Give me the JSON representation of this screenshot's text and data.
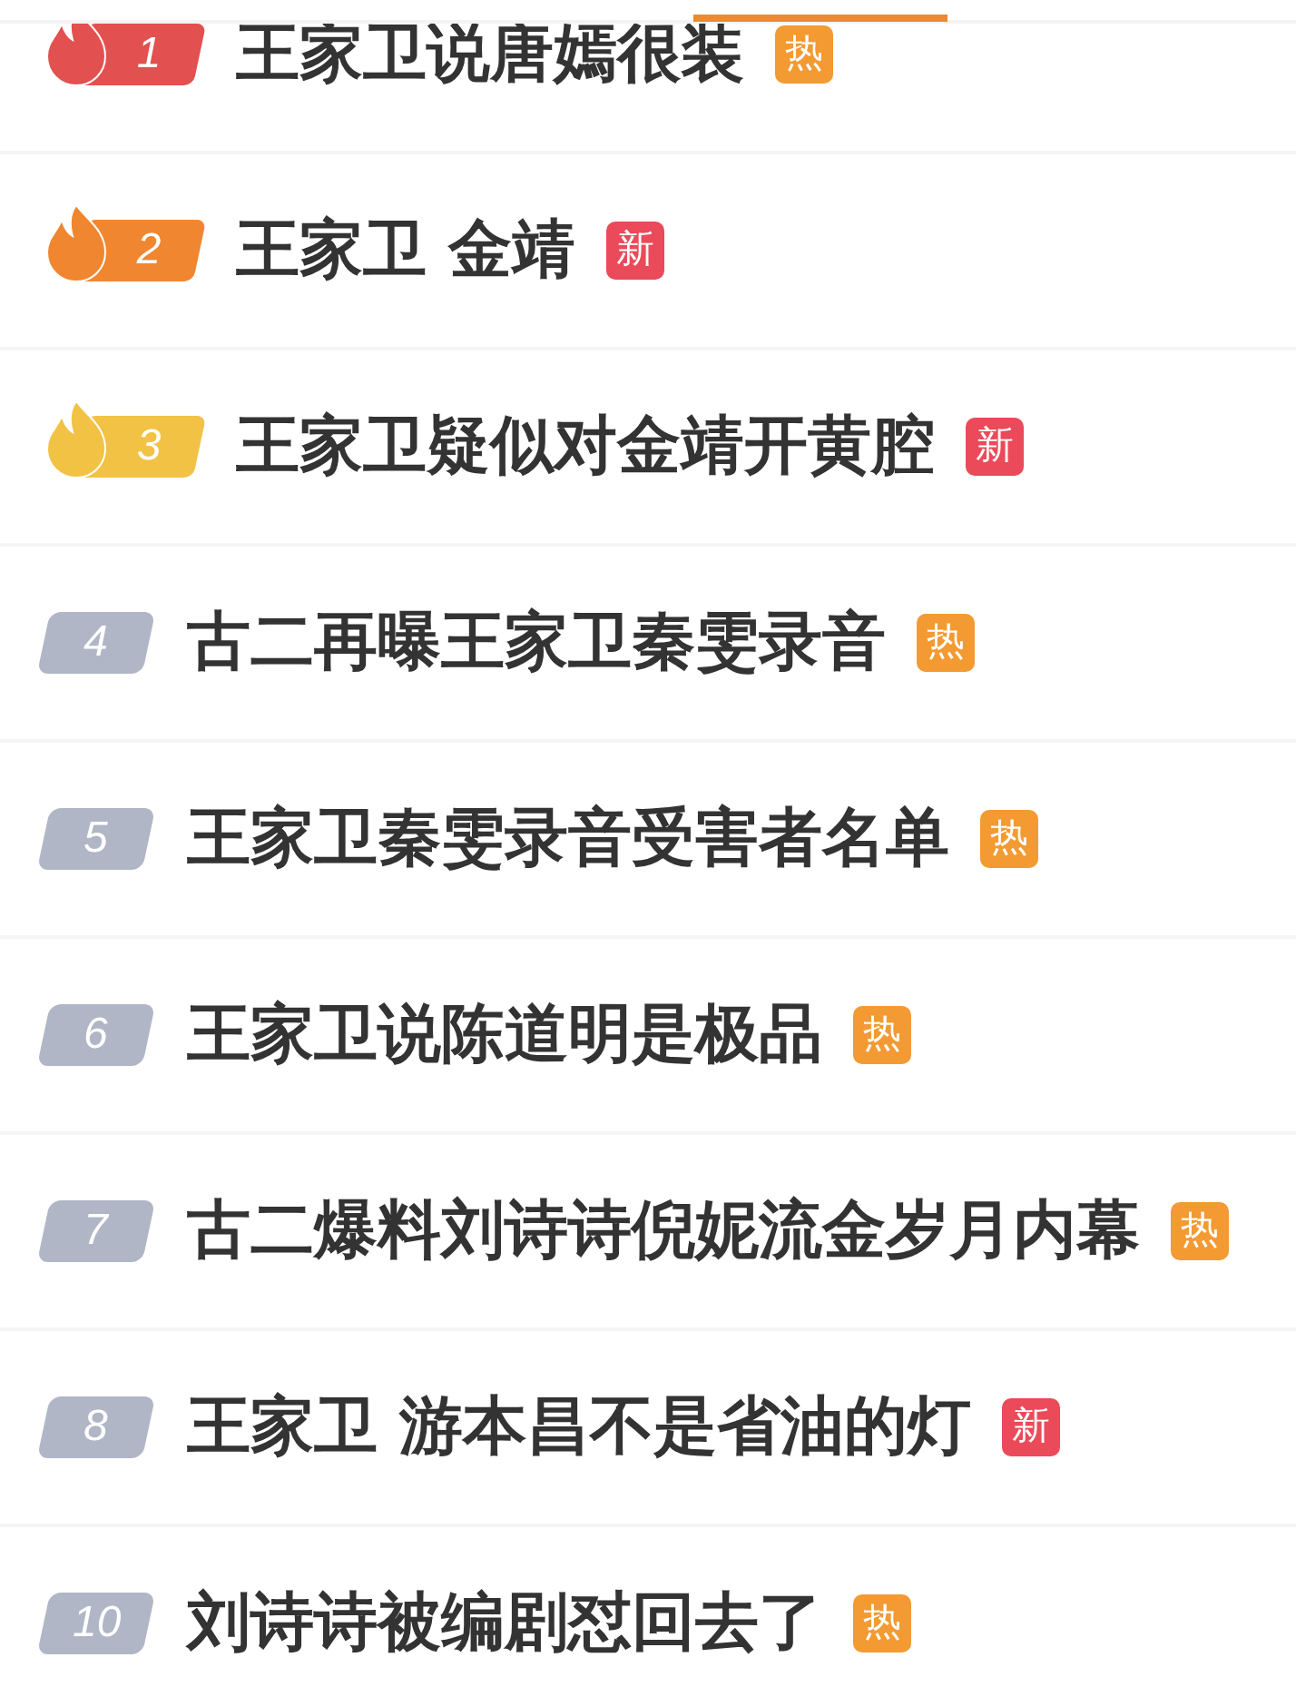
{
  "rows": [
    {
      "rank": "1",
      "kind": "top",
      "color": "#e2504f",
      "title": "王家卫说唐嫣很装",
      "tag": {
        "text": "热",
        "kind": "hot"
      }
    },
    {
      "rank": "2",
      "kind": "top",
      "color": "#f0862f",
      "title": "王家卫 金靖",
      "tag": {
        "text": "新",
        "kind": "new"
      }
    },
    {
      "rank": "3",
      "kind": "top",
      "color": "#f2c244",
      "title": "王家卫疑似对金靖开黄腔",
      "tag": {
        "text": "新",
        "kind": "new"
      }
    },
    {
      "rank": "4",
      "kind": "normal",
      "title": "古二再曝王家卫秦雯录音",
      "tag": {
        "text": "热",
        "kind": "hot"
      }
    },
    {
      "rank": "5",
      "kind": "normal",
      "title": "王家卫秦雯录音受害者名单",
      "tag": {
        "text": "热",
        "kind": "hot"
      }
    },
    {
      "rank": "6",
      "kind": "normal",
      "title": "王家卫说陈道明是极品",
      "tag": {
        "text": "热",
        "kind": "hot"
      }
    },
    {
      "rank": "7",
      "kind": "normal",
      "title": "古二爆料刘诗诗倪妮流金岁月内幕",
      "tag": {
        "text": "热",
        "kind": "hot"
      }
    },
    {
      "rank": "8",
      "kind": "normal",
      "title": "王家卫 游本昌不是省油的灯",
      "tag": {
        "text": "新",
        "kind": "new"
      }
    },
    {
      "rank": "10",
      "kind": "normal",
      "title": "刘诗诗被编剧怼回去了",
      "tag": {
        "text": "热",
        "kind": "hot"
      }
    }
  ]
}
